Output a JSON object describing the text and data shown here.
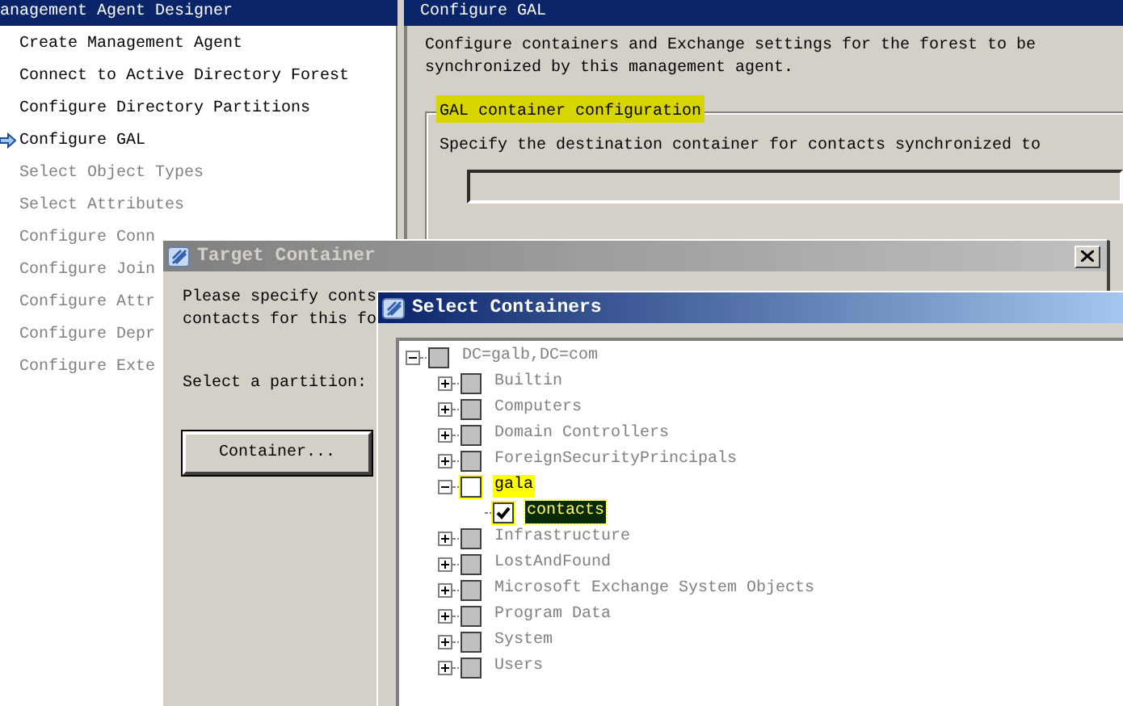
{
  "designer": {
    "title": "anagement Agent Designer",
    "steps": [
      {
        "label": "Create Management Agent",
        "enabled": true,
        "current": false
      },
      {
        "label": "Connect to Active Directory Forest",
        "enabled": true,
        "current": false
      },
      {
        "label": "Configure Directory Partitions",
        "enabled": true,
        "current": false
      },
      {
        "label": "Configure GAL",
        "enabled": true,
        "current": true
      },
      {
        "label": "Select Object Types",
        "enabled": false,
        "current": false
      },
      {
        "label": "Select Attributes",
        "enabled": false,
        "current": false
      },
      {
        "label": "Configure Conn",
        "enabled": false,
        "current": false
      },
      {
        "label": "Configure Join",
        "enabled": false,
        "current": false
      },
      {
        "label": "Configure Attr",
        "enabled": false,
        "current": false
      },
      {
        "label": "Configure Depr",
        "enabled": false,
        "current": false
      },
      {
        "label": "Configure Exte",
        "enabled": false,
        "current": false
      }
    ]
  },
  "page": {
    "title": "Configure GAL",
    "description": [
      "Configure containers and Exchange settings for the forest to be",
      "synchronized by this management agent."
    ],
    "group": {
      "label": "GAL container configuration",
      "highlighted": true,
      "text": "Specify the destination container for contacts synchronized to"
    }
  },
  "target_dialog": {
    "title": "Target Container",
    "prompt": [
      "Please specify conts",
      "contacts for this fo"
    ],
    "partition_label": "Select a partition:",
    "button": "Container..."
  },
  "select_dialog": {
    "title": "Select Containers",
    "tree": [
      {
        "label": "DC=galb,DC=com",
        "expanded": true,
        "checked": false,
        "enabled": false,
        "highlighted": false,
        "selected": false,
        "children": [
          {
            "label": "Builtin",
            "expanded": false,
            "checked": false,
            "enabled": false,
            "highlighted": false,
            "selected": false
          },
          {
            "label": "Computers",
            "expanded": false,
            "checked": false,
            "enabled": false,
            "highlighted": false,
            "selected": false
          },
          {
            "label": "Domain Controllers",
            "expanded": false,
            "checked": false,
            "enabled": false,
            "highlighted": false,
            "selected": false
          },
          {
            "label": "ForeignSecurityPrincipals",
            "expanded": false,
            "checked": false,
            "enabled": false,
            "highlighted": false,
            "selected": false
          },
          {
            "label": "gala",
            "expanded": true,
            "checked": false,
            "enabled": true,
            "highlighted": true,
            "selected": false,
            "children": [
              {
                "label": "contacts",
                "checked": true,
                "enabled": true,
                "highlighted": true,
                "selected": true
              }
            ]
          },
          {
            "label": "Infrastructure",
            "expanded": false,
            "checked": false,
            "enabled": false,
            "highlighted": false,
            "selected": false
          },
          {
            "label": "LostAndFound",
            "expanded": false,
            "checked": false,
            "enabled": false,
            "highlighted": false,
            "selected": false
          },
          {
            "label": "Microsoft Exchange System Objects",
            "expanded": false,
            "checked": false,
            "enabled": false,
            "highlighted": false,
            "selected": false
          },
          {
            "label": "Program Data",
            "expanded": false,
            "checked": false,
            "enabled": false,
            "highlighted": false,
            "selected": false
          },
          {
            "label": "System",
            "expanded": false,
            "checked": false,
            "enabled": false,
            "highlighted": false,
            "selected": false
          },
          {
            "label": "Users",
            "expanded": false,
            "checked": false,
            "enabled": false,
            "highlighted": false,
            "selected": false
          }
        ]
      }
    ]
  }
}
